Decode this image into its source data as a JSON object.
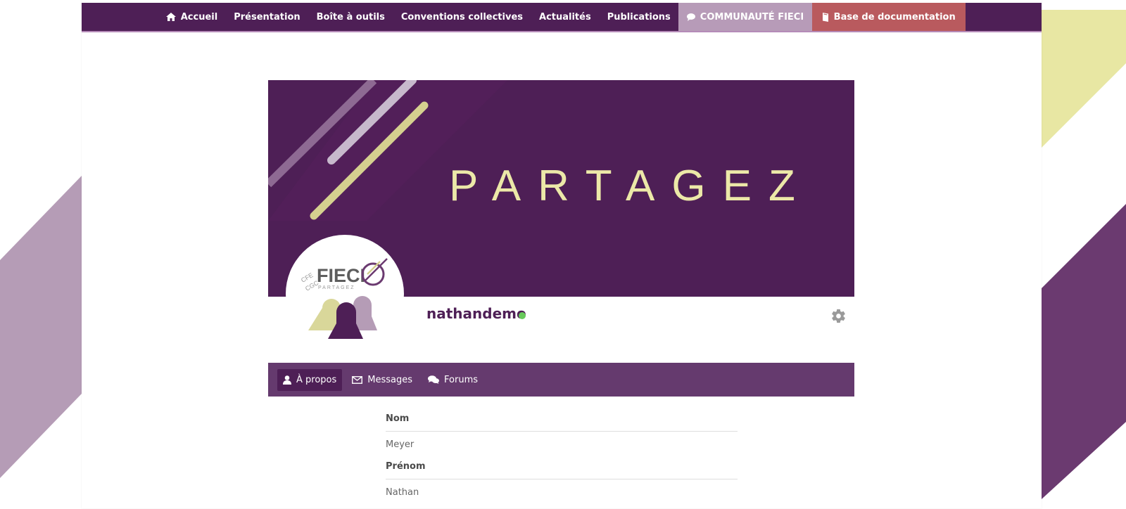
{
  "nav": {
    "items": [
      {
        "label": "Accueil",
        "icon": "home-icon"
      },
      {
        "label": "Présentation"
      },
      {
        "label": "Boîte à outils"
      },
      {
        "label": "Conventions collectives"
      },
      {
        "label": "Actualités"
      },
      {
        "label": "Publications"
      },
      {
        "label": "COMMUNAUTÉ FIECI",
        "icon": "chat-icon"
      },
      {
        "label": "Base de documentation",
        "icon": "book-icon"
      }
    ]
  },
  "banner": {
    "word": "PARTAGEZ"
  },
  "logo": {
    "text": "FIECI",
    "prefix": "CFE CGC",
    "tagline": "PARTAGEZ"
  },
  "profile": {
    "username": "nathandemo",
    "status": "online"
  },
  "tabs": [
    {
      "label": "À propos",
      "icon": "user-icon",
      "active": true
    },
    {
      "label": "Messages",
      "icon": "envelope-icon",
      "active": false
    },
    {
      "label": "Forums",
      "icon": "forum-icon",
      "active": false
    }
  ],
  "fields": [
    {
      "label": "Nom",
      "value": "Meyer"
    },
    {
      "label": "Prénom",
      "value": "Nathan"
    }
  ],
  "colors": {
    "brand_purple": "#4e1f56",
    "tab_bar": "#653a6e",
    "community_tab": "#b79bb8",
    "docs_tab": "#b95a5e",
    "accent_yellow": "#ece8a8",
    "online": "#68c95b"
  }
}
